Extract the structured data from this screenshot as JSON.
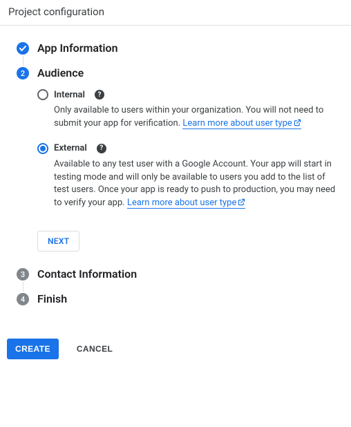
{
  "header": {
    "title": "Project configuration"
  },
  "steps": {
    "app_info": {
      "title": "App Information"
    },
    "audience": {
      "title": "Audience",
      "number": "2",
      "internal": {
        "label": "Internal",
        "desc": "Only available to users within your organization. You will not need to submit your app for verification. ",
        "learn": "Learn more about user type"
      },
      "external": {
        "label": "External",
        "desc": "Available to any test user with a Google Account. Your app will start in testing mode and will only be available to users you add to the list of test users. Once your app is ready to push to production, you may need to verify your app. ",
        "learn": "Learn more about user type"
      },
      "next_label": "NEXT"
    },
    "contact": {
      "title": "Contact Information",
      "number": "3"
    },
    "finish": {
      "title": "Finish",
      "number": "4"
    }
  },
  "footer": {
    "create_label": "CREATE",
    "cancel_label": "CANCEL"
  }
}
